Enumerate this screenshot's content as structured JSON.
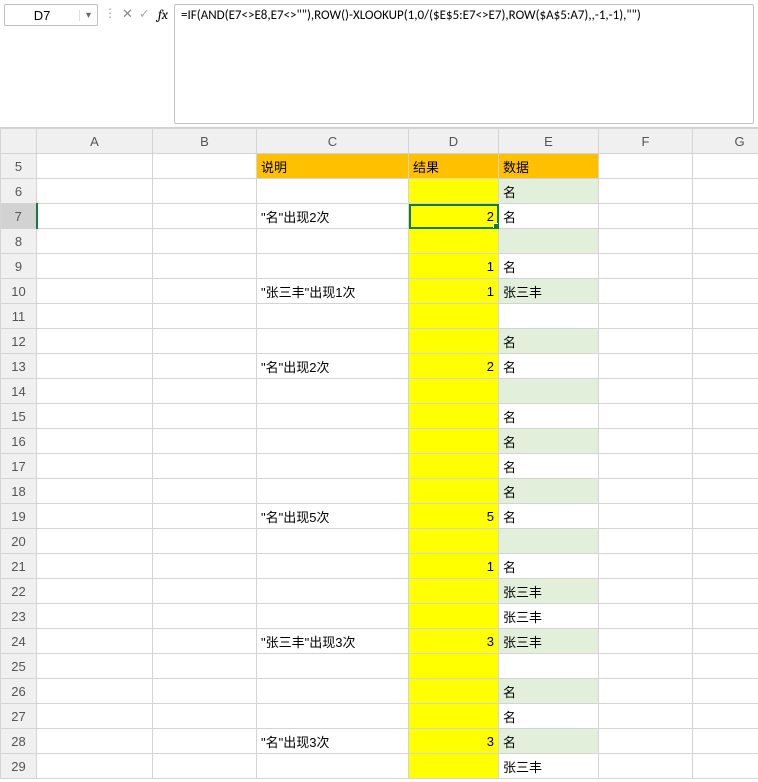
{
  "active_cell": "D7",
  "formula": "=IF(AND(E7<>E8,E7<>\"\"),ROW()-XLOOKUP(1,0/($E$5:E7<>E7),ROW($A$5:A7),,-1,-1),\"\")",
  "columns": [
    "A",
    "B",
    "C",
    "D",
    "E",
    "F",
    "G"
  ],
  "headers": {
    "C5": "说明",
    "D5": "结果",
    "E5": "数据"
  },
  "rows": {
    "6": {
      "C": "",
      "D": "",
      "E": "名"
    },
    "7": {
      "C": "\"名\"出现2次",
      "D": "2",
      "E": "名"
    },
    "8": {
      "C": "",
      "D": "",
      "E": ""
    },
    "9": {
      "C": "",
      "D": "1",
      "E": "名"
    },
    "10": {
      "C": "\"张三丰\"出现1次",
      "D": "1",
      "E": "张三丰"
    },
    "11": {
      "C": "",
      "D": "",
      "E": ""
    },
    "12": {
      "C": "",
      "D": "",
      "E": "名"
    },
    "13": {
      "C": "\"名\"出现2次",
      "D": "2",
      "E": "名"
    },
    "14": {
      "C": "",
      "D": "",
      "E": ""
    },
    "15": {
      "C": "",
      "D": "",
      "E": "名"
    },
    "16": {
      "C": "",
      "D": "",
      "E": "名"
    },
    "17": {
      "C": "",
      "D": "",
      "E": "名"
    },
    "18": {
      "C": "",
      "D": "",
      "E": "名"
    },
    "19": {
      "C": "\"名\"出现5次",
      "D": "5",
      "E": "名"
    },
    "20": {
      "C": "",
      "D": "",
      "E": ""
    },
    "21": {
      "C": "",
      "D": "1",
      "E": "名"
    },
    "22": {
      "C": "",
      "D": "",
      "E": "张三丰"
    },
    "23": {
      "C": "",
      "D": "",
      "E": "张三丰"
    },
    "24": {
      "C": "\"张三丰\"出现3次",
      "D": "3",
      "E": "张三丰"
    },
    "25": {
      "C": "",
      "D": "",
      "E": ""
    },
    "26": {
      "C": "",
      "D": "",
      "E": "名"
    },
    "27": {
      "C": "",
      "D": "",
      "E": "名"
    },
    "28": {
      "C": "\"名\"出现3次",
      "D": "3",
      "E": "名"
    },
    "29": {
      "C": "",
      "D": "",
      "E": "张三丰"
    }
  },
  "green_rows_E": [
    6,
    8,
    10,
    12,
    14,
    16,
    18,
    20,
    22,
    24,
    26,
    28
  ],
  "visible_row_start": 5,
  "visible_row_end": 29,
  "active_col": "D",
  "active_row": 7
}
